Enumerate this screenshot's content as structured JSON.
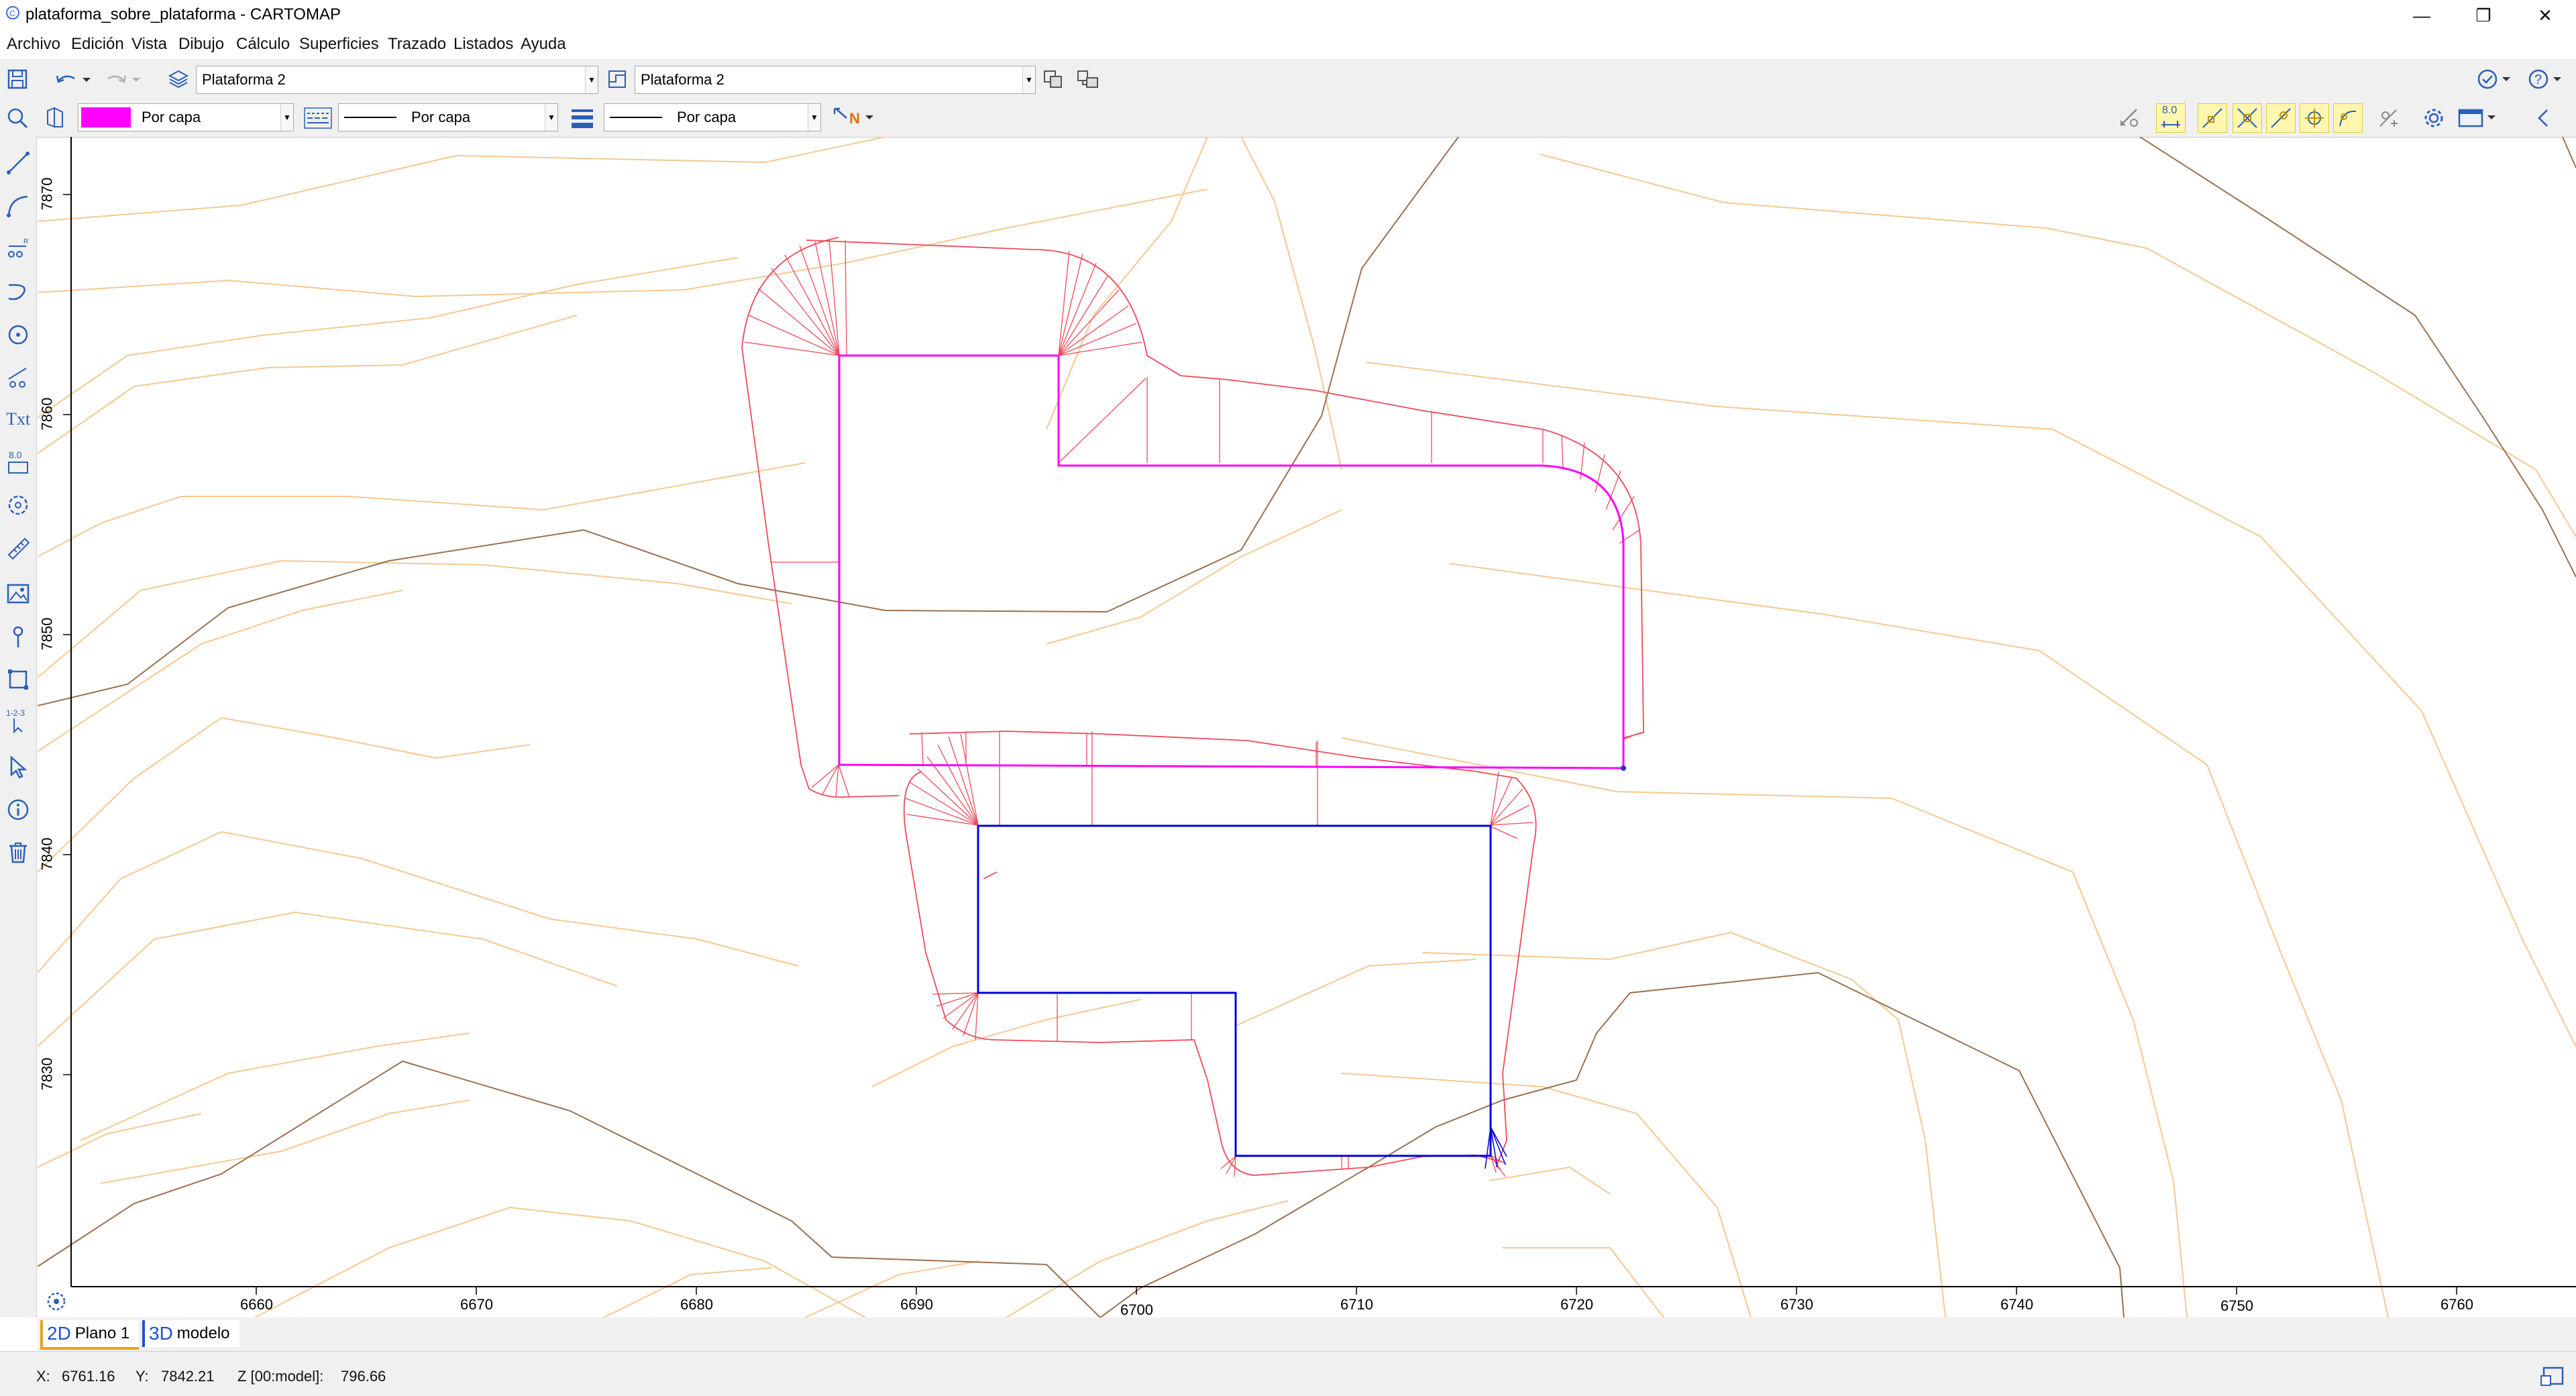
{
  "window": {
    "title": "plataforma_sobre_plataforma - CARTOMAP",
    "minimize": "—",
    "maximize": "❐",
    "close": "✕"
  },
  "menu": [
    "Archivo",
    "Edición",
    "Vista",
    "Dibujo",
    "Cálculo",
    "Superficies",
    "Trazado",
    "Listados",
    "Ayuda"
  ],
  "toolbar1": {
    "layer_combo": "Plataforma 2",
    "platform_combo": "Plataforma 2"
  },
  "toolbar2": {
    "color_label": "Por capa",
    "color_value": "#ff00ff",
    "linetype_label": "Por capa",
    "lineweight_label": "Por capa",
    "snap_value_label": "8.0",
    "north_label": "N"
  },
  "left_tools": [
    {
      "icon": "line-icon"
    },
    {
      "icon": "arc-icon"
    },
    {
      "icon": "spline-icon"
    },
    {
      "icon": "polyline-icon"
    },
    {
      "icon": "circle-icon"
    },
    {
      "icon": "points-line-icon"
    },
    {
      "icon": "text-icon",
      "label": "Txt"
    },
    {
      "icon": "elevation-icon",
      "label": "8.0"
    },
    {
      "icon": "polygon-icon"
    },
    {
      "icon": "measure-icon"
    },
    {
      "icon": "image-icon"
    },
    {
      "icon": "point-icon"
    },
    {
      "icon": "area-icon"
    },
    {
      "icon": "numbering-icon",
      "label": "1-2-3"
    },
    {
      "icon": "select-icon"
    },
    {
      "icon": "info-icon"
    },
    {
      "icon": "delete-icon"
    }
  ],
  "canvas": {
    "x_ticks": [
      "6660",
      "6670",
      "6680",
      "6690",
      "6700",
      "6710",
      "6720",
      "6730",
      "6740",
      "6750",
      "6760"
    ],
    "y_ticks": [
      "7870",
      "7860",
      "7850",
      "7840",
      "7830"
    ],
    "colors": {
      "contour_light": "#f6c890",
      "contour_dark": "#9b7050",
      "slope": "#f04a5a",
      "platform1": "#ff00ff",
      "platform2": "#0000dd"
    }
  },
  "tabs": [
    {
      "prefix": "2D",
      "label": "Plano 1"
    },
    {
      "prefix": "3D",
      "label": "modelo"
    }
  ],
  "status": {
    "x_label": "X:",
    "x_value": "6761.16",
    "y_label": "Y:",
    "y_value": "7842.21",
    "z_label": "Z [00:model]:",
    "z_value": "796.66"
  }
}
